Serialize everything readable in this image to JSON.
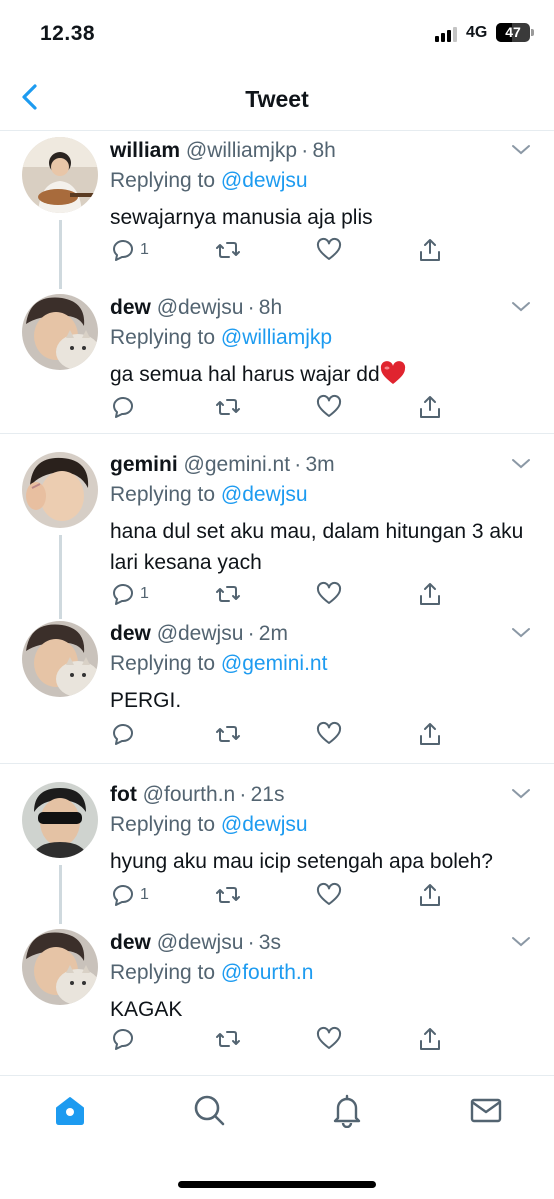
{
  "status_bar": {
    "time": "12.38",
    "network": "4G",
    "battery": "47",
    "battery_level": 0.47,
    "signal_bars": 3
  },
  "header": {
    "title": "Tweet"
  },
  "tweets": [
    {
      "name": "william",
      "handle": "@williamjkp",
      "dot": "·",
      "time": "8h",
      "replying_prefix": "Replying to",
      "replying_to": "@dewjsu",
      "text": "sewajarnya manusia aja plis",
      "reply_count": "1",
      "avatar": "guitar-boy-avatar"
    },
    {
      "name": "dew",
      "handle": "@dewjsu",
      "dot": "·",
      "time": "8h",
      "replying_prefix": "Replying to",
      "replying_to": "@williamjkp",
      "text": "ga semua hal harus wajar dd",
      "emoji": "red-heart",
      "reply_count": "",
      "avatar": "dew-with-cat-avatar"
    },
    {
      "name": "gemini",
      "handle": "@gemini.nt",
      "dot": "·",
      "time": "3m",
      "replying_prefix": "Replying to",
      "replying_to": "@dewjsu",
      "text": "hana dul set aku mau, dalam hitungan 3 aku lari kesana yach",
      "reply_count": "1",
      "avatar": "finger-heart-avatar"
    },
    {
      "name": "dew",
      "handle": "@dewjsu",
      "dot": "·",
      "time": "2m",
      "replying_prefix": "Replying to",
      "replying_to": "@gemini.nt",
      "text": "PERGI.",
      "reply_count": "",
      "avatar": "dew-with-cat-avatar"
    },
    {
      "name": "fot",
      "handle": "@fourth.n",
      "dot": "·",
      "time": "21s",
      "replying_prefix": "Replying to",
      "replying_to": "@dewjsu",
      "text": "hyung aku mau icip setengah apa boleh?",
      "reply_count": "1",
      "avatar": "sunglasses-avatar"
    },
    {
      "name": "dew",
      "handle": "@dewjsu",
      "dot": "·",
      "time": "3s",
      "replying_prefix": "Replying to",
      "replying_to": "@fourth.n",
      "text": "KAGAK",
      "reply_count": "",
      "avatar": "dew-with-cat-avatar"
    }
  ],
  "tab_bar": {
    "items": [
      "home-icon",
      "search-icon",
      "bell-icon",
      "mail-icon"
    ],
    "active": "home"
  },
  "colors": {
    "accent": "#1d9bf0",
    "text": "#0f1419",
    "muted": "#536471",
    "divider": "#e6ecf0",
    "thread_line": "#cfd9de"
  }
}
